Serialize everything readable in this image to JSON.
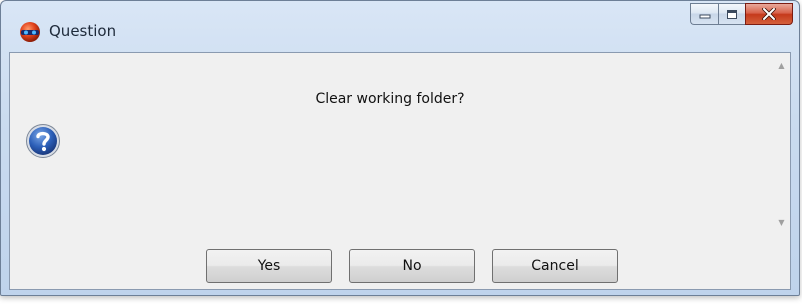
{
  "window": {
    "title": "Question",
    "app_icon": "red-sphere-app-icon",
    "controls": [
      {
        "name": "minimize",
        "icon": "minimize-icon"
      },
      {
        "name": "maximize",
        "icon": "maximize-icon"
      },
      {
        "name": "close",
        "icon": "close-icon"
      }
    ]
  },
  "dialog": {
    "message": "Clear working folder?",
    "icon": "question-icon"
  },
  "buttons": {
    "yes_label": "Yes",
    "no_label": "No",
    "cancel_label": "Cancel"
  },
  "colors": {
    "close_button": "#c5391b",
    "question_icon": "#1f4fa0",
    "client_background": "#f0f0f0"
  }
}
